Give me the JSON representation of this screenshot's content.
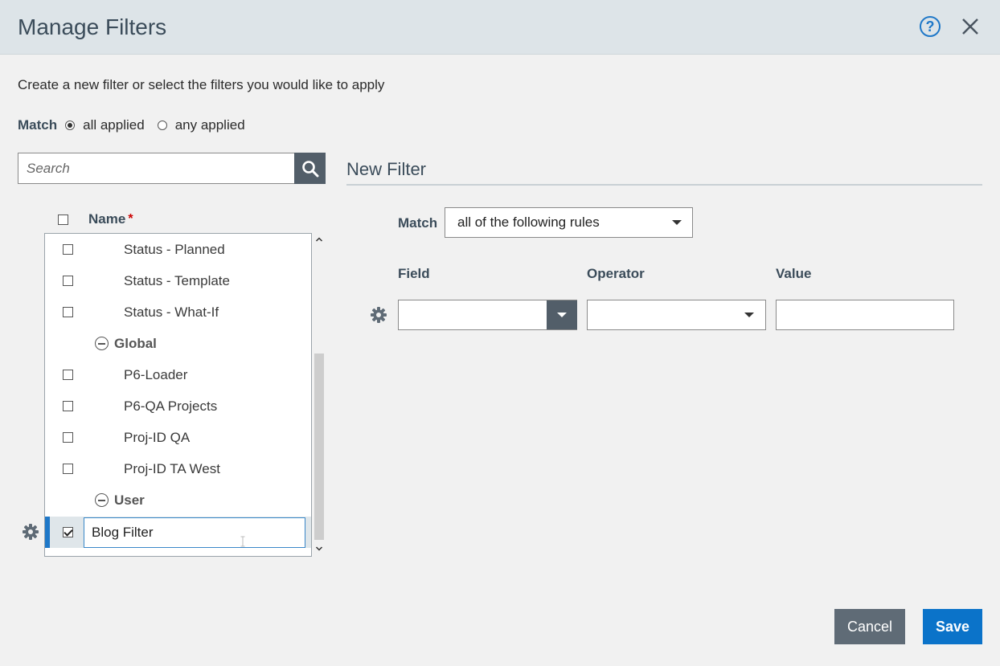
{
  "dialog": {
    "title": "Manage Filters",
    "help_label": "?",
    "subtitle": "Create a new filter or select the filters you would like to apply"
  },
  "match": {
    "label": "Match",
    "options": [
      {
        "label": "all applied",
        "selected": true
      },
      {
        "label": "any applied",
        "selected": false
      }
    ]
  },
  "search": {
    "placeholder": "Search",
    "value": ""
  },
  "list": {
    "header": {
      "name_label": "Name",
      "required_mark": "*"
    },
    "rows": [
      {
        "type": "item",
        "label": "Status - Planned",
        "checked": false
      },
      {
        "type": "item",
        "label": "Status - Template",
        "checked": false
      },
      {
        "type": "item",
        "label": "Status - What-If",
        "checked": false
      },
      {
        "type": "group",
        "label": "Global"
      },
      {
        "type": "item",
        "label": "P6-Loader",
        "checked": false
      },
      {
        "type": "item",
        "label": "P6-QA Projects",
        "checked": false
      },
      {
        "type": "item",
        "label": "Proj-ID QA",
        "checked": false
      },
      {
        "type": "item",
        "label": "Proj-ID TA West",
        "checked": false
      },
      {
        "type": "group",
        "label": "User"
      },
      {
        "type": "editing",
        "value": "Blog Filter",
        "checked": true
      }
    ]
  },
  "new_filter": {
    "title": "New Filter",
    "match_label": "Match",
    "match_value": "all of the following rules",
    "columns": {
      "field": "Field",
      "operator": "Operator",
      "value": "Value"
    },
    "rule": {
      "field": "",
      "operator": "",
      "value": ""
    }
  },
  "buttons": {
    "cancel": "Cancel",
    "save": "Save"
  },
  "colors": {
    "accent": "#0b73c9",
    "header_bg": "#dde4e8",
    "dark_button": "#5f6b76",
    "selection_marker": "#1f78c8"
  },
  "icons": [
    "help-icon",
    "close-icon",
    "search-icon",
    "gear-icon",
    "collapse-icon",
    "chevron-down-icon",
    "scroll-up-icon",
    "scroll-down-icon"
  ]
}
